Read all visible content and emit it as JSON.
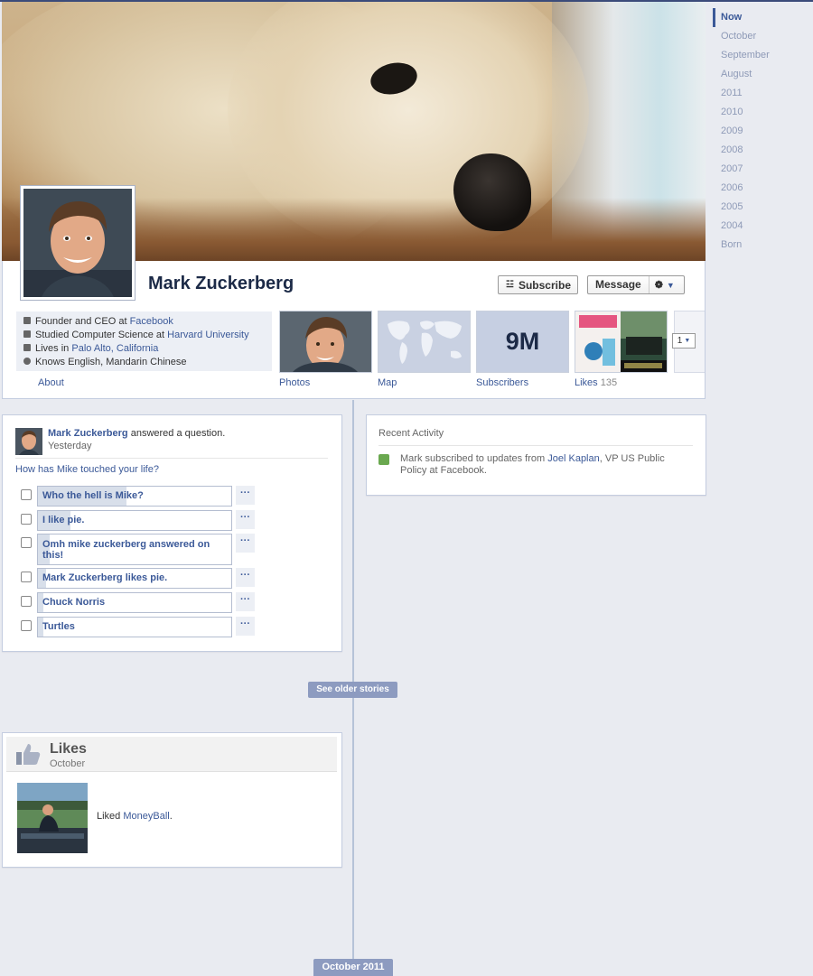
{
  "profile": {
    "name": "Mark Zuckerberg",
    "subscribe_label": "Subscribe",
    "message_label": "Message",
    "about": [
      {
        "prefix": "Founder and CEO at ",
        "link": "Facebook",
        "suffix": ""
      },
      {
        "prefix": "Studied Computer Science at ",
        "link": "Harvard University",
        "suffix": ""
      },
      {
        "prefix": "Lives in ",
        "link": "Palo Alto, California",
        "suffix": ""
      },
      {
        "prefix": "Knows English, Mandarin Chinese",
        "link": "",
        "suffix": ""
      }
    ],
    "tabs": {
      "about": "About",
      "photos": "Photos",
      "map": "Map",
      "subscribers": "Subscribers",
      "subscribers_count": "9M",
      "likes": "Likes",
      "likes_count": "135",
      "more_count": "1"
    }
  },
  "timeline_nav": [
    "Now",
    "October",
    "September",
    "August",
    "2011",
    "2010",
    "2009",
    "2008",
    "2007",
    "2006",
    "2005",
    "2004",
    "Born"
  ],
  "question_story": {
    "author": "Mark Zuckerberg",
    "action": " answered a question.",
    "time": "Yesterday",
    "question": "How has Mike touched your life?",
    "options": [
      {
        "label": "Who the hell is Mike?",
        "share": 0.46
      },
      {
        "label": "I like pie.",
        "share": 0.17
      },
      {
        "label": "Omh mike zuckerberg answered on this!",
        "share": 0.06
      },
      {
        "label": "Mark Zuckerberg likes pie.",
        "share": 0.04
      },
      {
        "label": "Chuck Norris",
        "share": 0.03
      },
      {
        "label": "Turtles",
        "share": 0.03
      }
    ],
    "more_label": "···"
  },
  "recent_activity": {
    "title": "Recent Activity",
    "text_prefix": "Mark subscribed to updates from ",
    "link": "Joel Kaplan",
    "text_suffix": ", VP US Public Policy at Facebook."
  },
  "see_older": "See older stories",
  "likes_story": {
    "title": "Likes",
    "month": "October",
    "text_prefix": "Liked ",
    "link": "MoneyBall",
    "text_suffix": "."
  },
  "section_badge": "October 2011",
  "colors": {
    "brand": "#3b5998",
    "timeline_badge": "#8d9bc0",
    "page_background": "#e9ebf1"
  }
}
